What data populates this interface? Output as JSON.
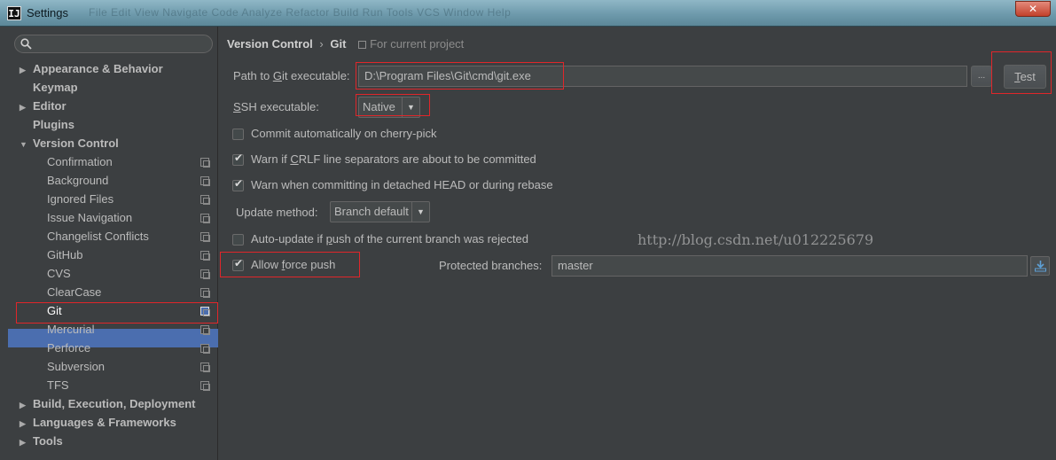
{
  "window": {
    "title": "Settings",
    "app_icon_text": "IJ",
    "blurred_menu_text": "File  Edit  View  Navigate  Code  Analyze  Refactor  Build  Run  Tools  VCS  Window  Help",
    "close_glyph": "✕"
  },
  "sidebar": {
    "search": {
      "value": "",
      "placeholder": ""
    },
    "items": [
      {
        "label": "Appearance & Behavior",
        "level": 0,
        "expandable": true,
        "expanded": false
      },
      {
        "label": "Keymap",
        "level": 0,
        "expandable": false
      },
      {
        "label": "Editor",
        "level": 0,
        "expandable": true,
        "expanded": false
      },
      {
        "label": "Plugins",
        "level": 0,
        "expandable": false
      },
      {
        "label": "Version Control",
        "level": 0,
        "expandable": true,
        "expanded": true
      },
      {
        "label": "Confirmation",
        "level": 1
      },
      {
        "label": "Background",
        "level": 1
      },
      {
        "label": "Ignored Files",
        "level": 1
      },
      {
        "label": "Issue Navigation",
        "level": 1
      },
      {
        "label": "Changelist Conflicts",
        "level": 1
      },
      {
        "label": "GitHub",
        "level": 1
      },
      {
        "label": "CVS",
        "level": 1
      },
      {
        "label": "ClearCase",
        "level": 1
      },
      {
        "label": "Git",
        "level": 1,
        "selected": true
      },
      {
        "label": "Mercurial",
        "level": 1
      },
      {
        "label": "Perforce",
        "level": 1
      },
      {
        "label": "Subversion",
        "level": 1
      },
      {
        "label": "TFS",
        "level": 1
      },
      {
        "label": "Build, Execution, Deployment",
        "level": 0,
        "expandable": true,
        "expanded": false
      },
      {
        "label": "Languages & Frameworks",
        "level": 0,
        "expandable": true,
        "expanded": false
      },
      {
        "label": "Tools",
        "level": 0,
        "expandable": true,
        "expanded": false
      }
    ]
  },
  "breadcrumb": {
    "parent": "Version Control",
    "separator": "›",
    "current": "Git",
    "scope": "For current project"
  },
  "git_settings": {
    "path_label_pre": "Path to ",
    "path_label_mn": "G",
    "path_label_post": "it executable:",
    "path_value": "D:\\Program Files\\Git\\cmd\\git.exe",
    "browse_label": "...",
    "test_label_mn": "T",
    "test_label_post": "est",
    "ssh_label_mn": "S",
    "ssh_label_post": "SH executable:",
    "ssh_value": "Native",
    "commit_cherry_pick": {
      "label": "Commit automatically on cherry-pick",
      "checked": false
    },
    "warn_crlf": {
      "label_pre": "Warn if ",
      "label_mn": "C",
      "label_post": "RLF line separators are about to be committed",
      "checked": true
    },
    "warn_detached": {
      "label": "Warn when committing in detached HEAD or during rebase",
      "checked": true
    },
    "update_method_label": "Update method:",
    "update_method_value": "Branch default",
    "auto_update": {
      "label_pre": "Auto-update if ",
      "label_mn": "p",
      "label_post": "ush of the current branch was rejected",
      "checked": false
    },
    "allow_force_push": {
      "label_pre": "Allow ",
      "label_mn": "f",
      "label_post": "orce push",
      "checked": true
    },
    "protected_branches_label": "Protected branches:",
    "protected_branches_value": "master"
  },
  "watermark": "http://blog.csdn.net/u012225679",
  "colors": {
    "background": "#3c3f41",
    "selection": "#4b6eaf",
    "highlight_box": "#e0262a",
    "text": "#bbbbbb"
  }
}
